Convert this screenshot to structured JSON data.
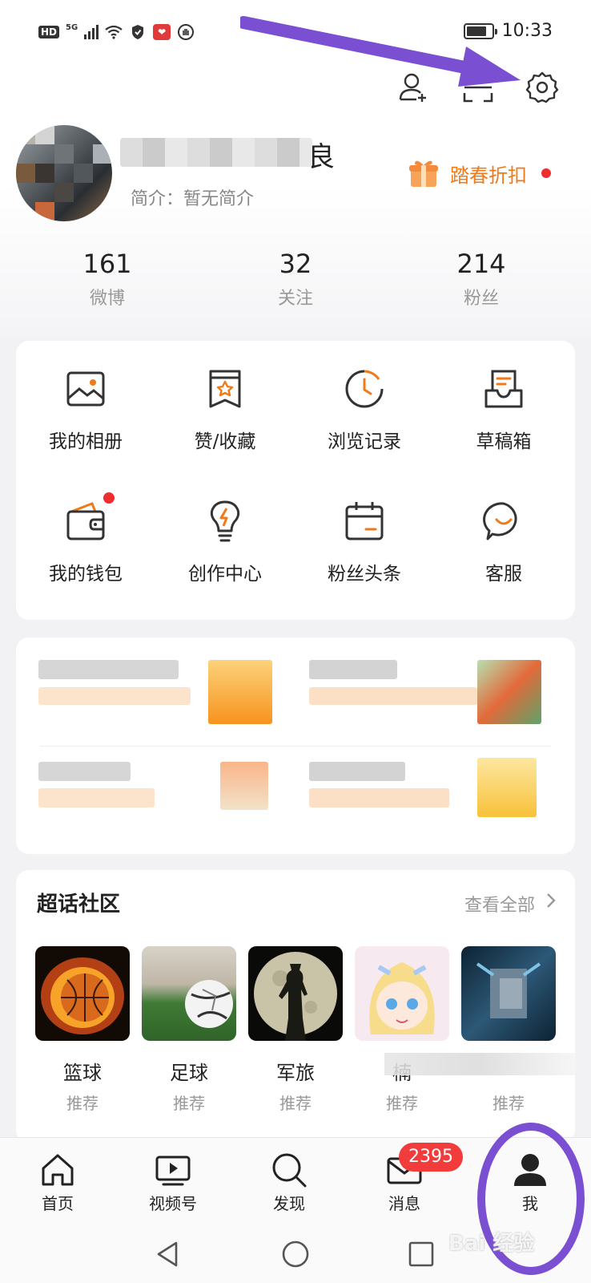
{
  "status_bar": {
    "hd": "HD",
    "network": "5G",
    "time": "10:33",
    "battery_level": 0.8
  },
  "top_actions": {
    "icons": [
      "add-friend-icon",
      "scan-icon",
      "gear-icon"
    ]
  },
  "profile": {
    "nickname_visible_char": "良",
    "bio": "简介：暂无简介",
    "promo_label": "踏春折扣"
  },
  "stats": [
    {
      "value": "161",
      "label": "微博"
    },
    {
      "value": "32",
      "label": "关注"
    },
    {
      "value": "214",
      "label": "粉丝"
    }
  ],
  "grid": [
    {
      "label": "我的相册",
      "icon": "photo-album-icon"
    },
    {
      "label": "赞/收藏",
      "icon": "like-favorite-icon"
    },
    {
      "label": "浏览记录",
      "icon": "history-icon"
    },
    {
      "label": "草稿箱",
      "icon": "drafts-icon"
    },
    {
      "label": "我的钱包",
      "icon": "wallet-icon"
    },
    {
      "label": "创作中心",
      "icon": "creator-center-icon"
    },
    {
      "label": "粉丝头条",
      "icon": "fans-headline-icon"
    },
    {
      "label": "客服",
      "icon": "customer-service-icon"
    }
  ],
  "super_topic": {
    "title": "超话社区",
    "more": "查看全部",
    "tiles": [
      {
        "name": "篮球",
        "sub": "推荐"
      },
      {
        "name": "足球",
        "sub": "推荐"
      },
      {
        "name": "军旅",
        "sub": "推荐"
      },
      {
        "name": "楠",
        "sub": "推荐"
      },
      {
        "name": "",
        "sub": "推荐"
      }
    ]
  },
  "bottom_nav": [
    {
      "label": "首页",
      "icon": "home-icon"
    },
    {
      "label": "视频号",
      "icon": "video-icon"
    },
    {
      "label": "发现",
      "icon": "discover-icon"
    },
    {
      "label": "消息",
      "icon": "message-icon"
    },
    {
      "label": "我",
      "icon": "profile-icon"
    }
  ],
  "message_badge": "2395",
  "colors": {
    "accent_orange": "#f07a1a",
    "badge_red": "#f23c3c",
    "annotation_purple": "#7a4fd1"
  },
  "watermark": "Bai 经验"
}
